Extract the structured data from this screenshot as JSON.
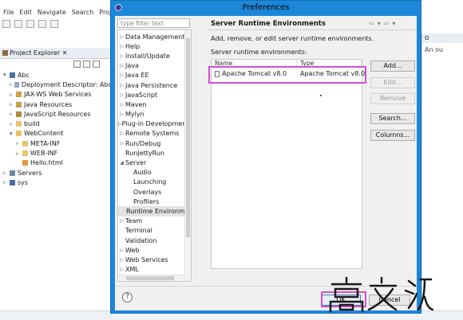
{
  "menubar": [
    "File",
    "Edit",
    "Navigate",
    "Search",
    "Proje"
  ],
  "project_explorer": {
    "title": "Project Explorer",
    "close": "✕",
    "items": [
      {
        "twisty": "▾",
        "icon": "proj",
        "label": "Abc"
      },
      {
        "twisty": "▹",
        "icon": "dd",
        "label": "Deployment Descriptor: Abc"
      },
      {
        "twisty": "▹",
        "icon": "jar",
        "label": "JAX-WS Web Services"
      },
      {
        "twisty": "▹",
        "icon": "jar",
        "label": "Java Resources"
      },
      {
        "twisty": "▹",
        "icon": "js",
        "label": "JavaScript Resources"
      },
      {
        "twisty": "▹",
        "icon": "folder",
        "label": "build"
      },
      {
        "twisty": "▾",
        "icon": "folder",
        "label": "WebContent"
      },
      {
        "twisty": "▹",
        "icon": "folder",
        "label": "META-INF"
      },
      {
        "twisty": "▹",
        "icon": "folder",
        "label": "WEB-INF"
      },
      {
        "twisty": "",
        "icon": "html",
        "label": "Hello.html"
      },
      {
        "twisty": "▹",
        "icon": "srv",
        "label": "Servers"
      },
      {
        "twisty": "▹",
        "icon": "proj",
        "label": "sys"
      }
    ]
  },
  "right_panel": {
    "tab": "O",
    "text": "An ou"
  },
  "dialog": {
    "title": "Preferences",
    "filter_placeholder": "type filter text",
    "tree": [
      {
        "twisty": "▷",
        "label": "Data Management",
        "indent": 0
      },
      {
        "twisty": "▷",
        "label": "Help",
        "indent": 0
      },
      {
        "twisty": "▷",
        "label": "Install/Update",
        "indent": 0
      },
      {
        "twisty": "▷",
        "label": "Java",
        "indent": 0
      },
      {
        "twisty": "▷",
        "label": "Java EE",
        "indent": 0
      },
      {
        "twisty": "▷",
        "label": "Java Persistence",
        "indent": 0
      },
      {
        "twisty": "▷",
        "label": "JavaScript",
        "indent": 0
      },
      {
        "twisty": "▷",
        "label": "Maven",
        "indent": 0
      },
      {
        "twisty": "▷",
        "label": "Mylyn",
        "indent": 0
      },
      {
        "twisty": "▷",
        "label": "Plug-in Development",
        "indent": 0
      },
      {
        "twisty": "▷",
        "label": "Remote Systems",
        "indent": 0
      },
      {
        "twisty": "▷",
        "label": "Run/Debug",
        "indent": 0
      },
      {
        "twisty": "",
        "label": "RunJettyRun",
        "indent": 0
      },
      {
        "twisty": "◢",
        "label": "Server",
        "indent": 0
      },
      {
        "twisty": "",
        "label": "Audio",
        "indent": 1
      },
      {
        "twisty": "",
        "label": "Launching",
        "indent": 1
      },
      {
        "twisty": "",
        "label": "Overlays",
        "indent": 1
      },
      {
        "twisty": "",
        "label": "Profilers",
        "indent": 1
      },
      {
        "twisty": "",
        "label": "Runtime Environments",
        "indent": 1,
        "selected": true
      },
      {
        "twisty": "▷",
        "label": "Team",
        "indent": 0
      },
      {
        "twisty": "",
        "label": "Terminal",
        "indent": 0
      },
      {
        "twisty": "",
        "label": "Validation",
        "indent": 0
      },
      {
        "twisty": "▷",
        "label": "Web",
        "indent": 0
      },
      {
        "twisty": "▷",
        "label": "Web Services",
        "indent": 0
      },
      {
        "twisty": "▷",
        "label": "XML",
        "indent": 0
      }
    ],
    "page_title": "Server Runtime Environments",
    "nav_arrows": [
      "⇦",
      "▾",
      "⇨",
      "▾"
    ],
    "description": "Add, remove, or edit server runtime environments.",
    "list_label": "Server runtime environments:",
    "table": {
      "columns": [
        "Name",
        "Type"
      ],
      "rows": [
        {
          "name": "Apache Tomcat v8.0",
          "type": "Apache Tomcat v8.0",
          "checked": false
        }
      ]
    },
    "buttons": {
      "add": "Add...",
      "edit": "Edit...",
      "remove": "Remove",
      "search": "Search...",
      "columns": "Columns...",
      "help": "?",
      "ok": "OK",
      "cancel": "Cancel"
    },
    "highlight_color": "#d44fd0",
    "accent_color": "#1c87d9"
  }
}
